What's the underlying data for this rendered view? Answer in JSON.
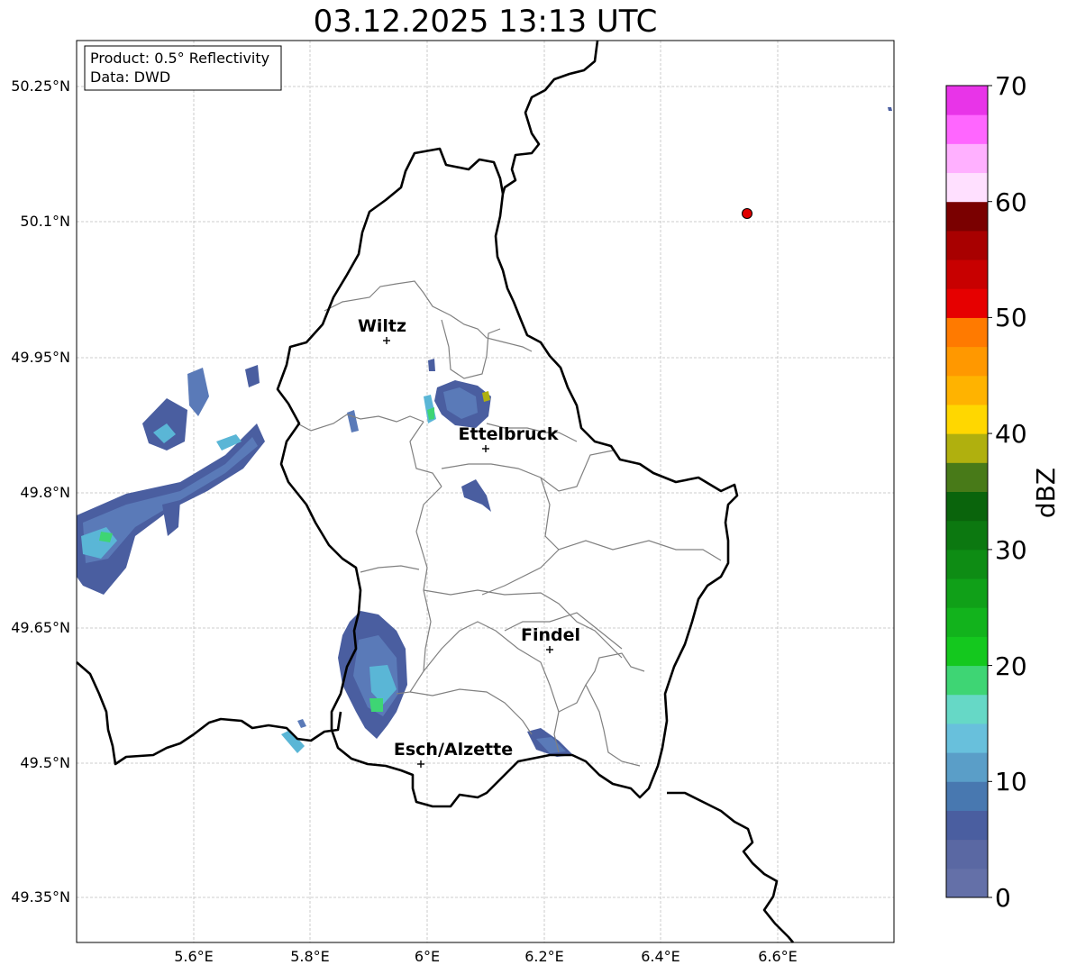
{
  "title": "03.12.2025 13:13 UTC",
  "info_box": {
    "product": "Product: 0.5° Reflectivity",
    "data_source": "Data: DWD"
  },
  "axes": {
    "lat_ticks": [
      "50.25°N",
      "50.1°N",
      "49.95°N",
      "49.8°N",
      "49.65°N",
      "49.5°N",
      "49.35°N"
    ],
    "lon_ticks": [
      "5.6°E",
      "5.8°E",
      "6°E",
      "6.2°E",
      "6.4°E",
      "6.6°E"
    ],
    "grid": true
  },
  "cities": [
    {
      "name": "Wiltz"
    },
    {
      "name": "Ettelbruck"
    },
    {
      "name": "Findel"
    },
    {
      "name": "Esch/Alzette"
    }
  ],
  "colorbar": {
    "label": "dBZ",
    "ticks": [
      "70",
      "60",
      "50",
      "40",
      "30",
      "20",
      "10",
      "0"
    ],
    "min": 0,
    "max": 70,
    "step": 2.5,
    "colors": [
      "#6470a8",
      "#5a68a3",
      "#4a5ea0",
      "#4878b0",
      "#5a9ec8",
      "#68c0dc",
      "#66d8c6",
      "#3ed574",
      "#14c81e",
      "#12b31c",
      "#10a018",
      "#0e8c14",
      "#0c7810",
      "#0a640c",
      "#487a18",
      "#b0b00e",
      "#ffd700",
      "#ffb300",
      "#ff9800",
      "#ff7a00",
      "#e60000",
      "#c80000",
      "#a80000",
      "#7a0000",
      "#ffe0ff",
      "#ffb0ff",
      "#ff66ff",
      "#e834e8"
    ]
  },
  "marker": {
    "type": "red-dot",
    "color": "#e00000"
  },
  "colors": {
    "border_thick": "#000000",
    "border_district": "#808080",
    "grid": "#bfbfbf"
  }
}
